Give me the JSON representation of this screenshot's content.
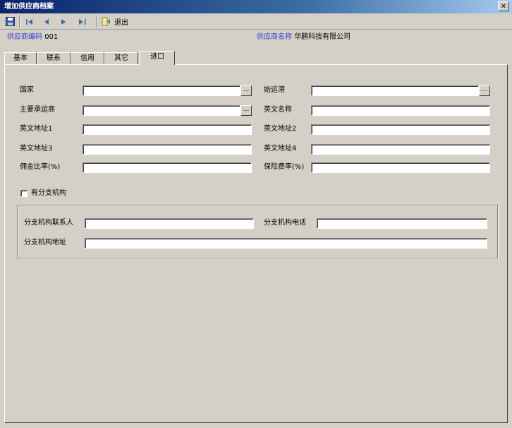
{
  "window": {
    "title": "增加供应商档案",
    "close_glyph": "✕"
  },
  "toolbar": {
    "exit_label": "退出",
    "icons": [
      "save-icon",
      "first-record-icon",
      "prev-record-icon",
      "next-record-icon",
      "last-record-icon",
      "exit-icon"
    ]
  },
  "header": {
    "supplier_code_label": "供应商编码",
    "supplier_code_value": "001",
    "supplier_name_label": "供应商名称",
    "supplier_name_value": "华鹏科技有限公司"
  },
  "tabs": [
    {
      "label": "基本"
    },
    {
      "label": "联系"
    },
    {
      "label": "信用"
    },
    {
      "label": "其它"
    },
    {
      "label": "进口",
      "active": true
    }
  ],
  "form": {
    "country_label": "国家",
    "origin_label": "始运港",
    "main_account_label": "主要承运商",
    "english_name_label": "英文名称",
    "en_addr1_label": "英文地址1",
    "en_addr2_label": "英文地址2",
    "en_addr3_label": "英文地址3",
    "en_addr4_label": "英文地址4",
    "commission_label": "佣金比率(%)",
    "insurance_label": "保险费率(%)",
    "ellipsis": "...",
    "has_branch_label": "有分支机构",
    "branch_contact_label": "分支机构联系人",
    "branch_phone_label": "分支机构电话",
    "branch_address_label": "分支机构地址"
  }
}
